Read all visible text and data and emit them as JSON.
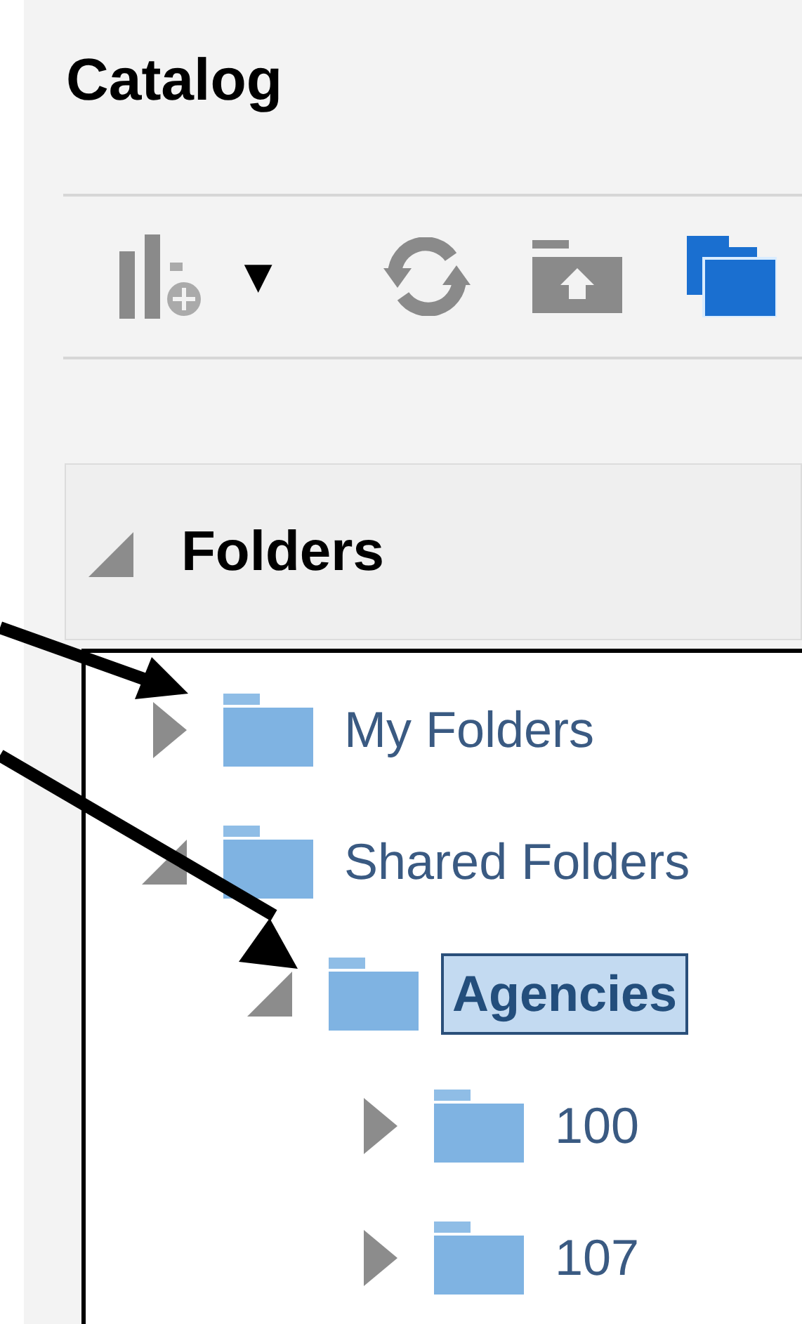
{
  "title": "Catalog",
  "toolbar": {
    "dropdown_caret": "▼"
  },
  "folders_panel": {
    "title": "Folders",
    "expanded": true,
    "tree": [
      {
        "label": "My Folders",
        "expanded": false,
        "selected": false
      },
      {
        "label": "Shared Folders",
        "expanded": true,
        "selected": false,
        "children": [
          {
            "label": "Agencies",
            "expanded": true,
            "selected": true,
            "children": [
              {
                "label": "100",
                "expanded": false,
                "selected": false
              },
              {
                "label": "107",
                "expanded": false,
                "selected": false
              }
            ]
          }
        ]
      }
    ]
  }
}
